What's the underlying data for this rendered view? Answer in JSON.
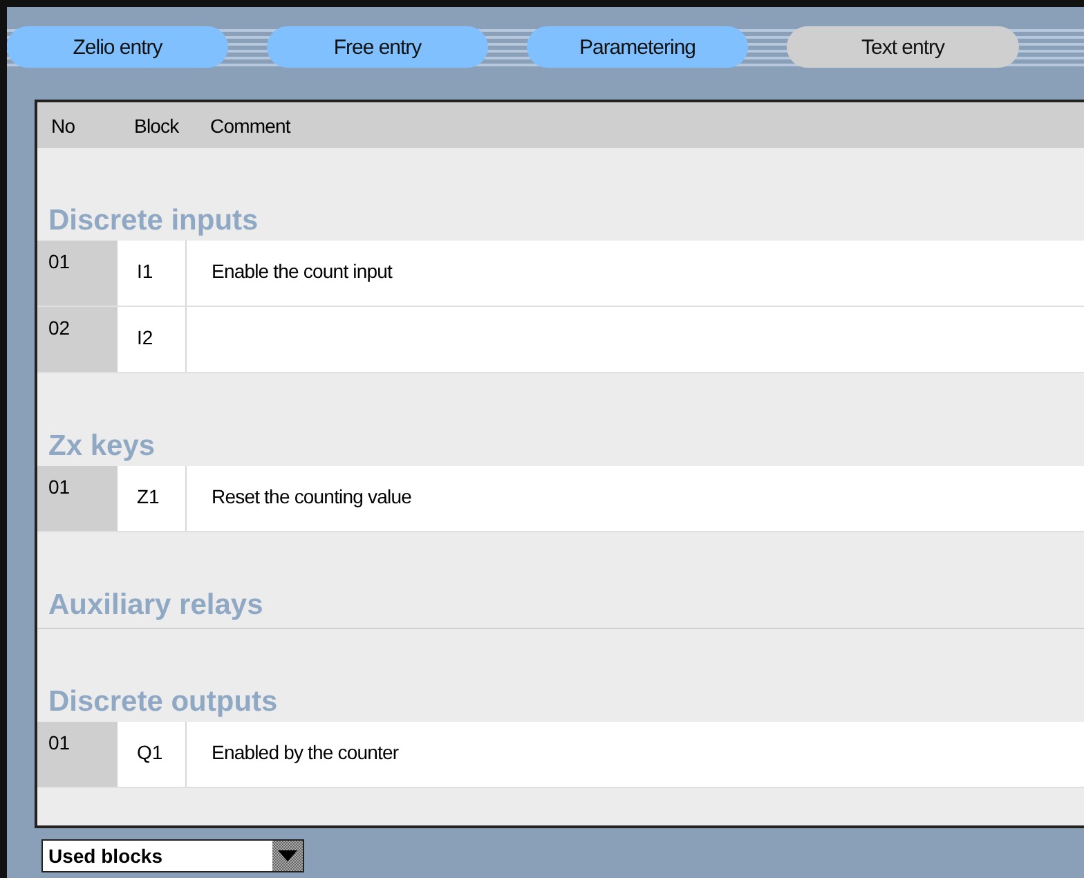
{
  "tabs": [
    {
      "label": "Zelio entry",
      "selected": false
    },
    {
      "label": "Free entry",
      "selected": false
    },
    {
      "label": "Parametering",
      "selected": false
    },
    {
      "label": "Text entry",
      "selected": true
    }
  ],
  "table": {
    "columns": [
      "No",
      "Block",
      "Comment"
    ],
    "sections": [
      {
        "title": "Discrete inputs",
        "rows": [
          {
            "no": "01",
            "block": "I1",
            "comment": "Enable the count input"
          },
          {
            "no": "02",
            "block": "I2"
          }
        ]
      },
      {
        "title": "Zx keys",
        "rows": [
          {
            "no": "01",
            "block": "Z1",
            "comment": "Reset the counting value"
          }
        ]
      },
      {
        "title": "Auxiliary relays"
      },
      {
        "title": "Discrete outputs",
        "rows": [
          {
            "no": "01",
            "block": "Q1",
            "comment": "Enabled by the counter"
          }
        ]
      }
    ]
  },
  "filter": {
    "value": "Used blocks"
  }
}
